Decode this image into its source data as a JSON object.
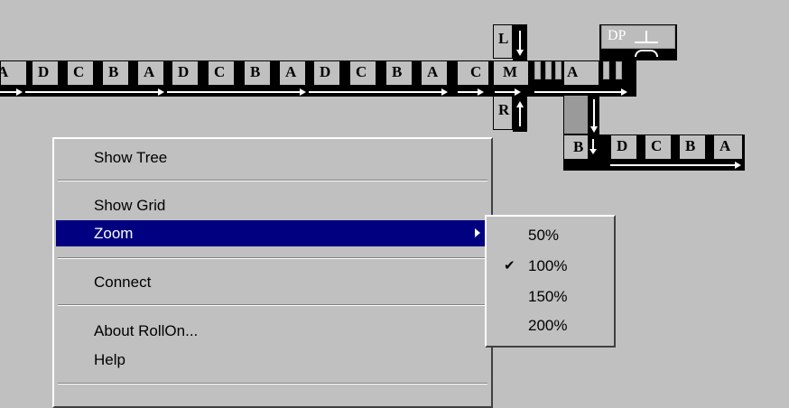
{
  "conveyor": {
    "main_row": [
      "A",
      "D",
      "C",
      "B",
      "A",
      "D",
      "C",
      "B",
      "A",
      "D",
      "C",
      "B",
      "A",
      "C",
      "M",
      "A"
    ],
    "left_tile": "L",
    "right_tile": "R",
    "dp_tile": "DP",
    "branch_row": [
      "B",
      "D",
      "C",
      "B",
      "A"
    ]
  },
  "context_menu": {
    "items": [
      {
        "label": "Show Tree"
      },
      {
        "label": "Show Grid"
      },
      {
        "label": "Zoom"
      },
      {
        "label": "Connect"
      },
      {
        "label": "About RollOn..."
      },
      {
        "label": "Help"
      }
    ]
  },
  "zoom_submenu": {
    "options": [
      "50%",
      "100%",
      "150%",
      "200%"
    ],
    "checked": "100%"
  },
  "colors": {
    "background": "#c0c0c0",
    "menu_highlight": "#000080",
    "tile_border": "#000000"
  }
}
